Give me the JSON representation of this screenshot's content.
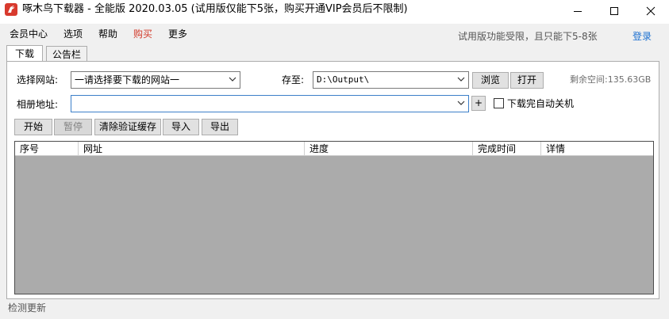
{
  "window": {
    "title": "啄木鸟下载器 - 全能版 2020.03.05 (试用版仅能下5张，购买开通VIP会员后不限制)"
  },
  "menu": {
    "items": [
      "会员中心",
      "选项",
      "帮助",
      "购买",
      "更多"
    ],
    "accent_color": "#d23a2a"
  },
  "header": {
    "trial_note": "试用版功能受限，且只能下5-8张",
    "login": "登录",
    "login_color": "#1a6fd0"
  },
  "tabs": [
    "下载",
    "公告栏"
  ],
  "form": {
    "site_label": "选择网站:",
    "site_value": "一请选择要下载的网站一",
    "save_label": "存至:",
    "save_value": "D:\\Output\\",
    "browse": "浏览",
    "open": "打开",
    "free_space": "剩余空间:135.63GB",
    "album_label": "相册地址:",
    "album_value": "",
    "plus": "+",
    "shutdown_label": "下载完自动关机",
    "shutdown_checked": false
  },
  "actions": {
    "start": "开始",
    "pause": "暂停",
    "clear_cache": "清除验证缓存",
    "import": "导入",
    "export": "导出"
  },
  "table": {
    "columns": [
      "序号",
      "网址",
      "进度",
      "完成时间",
      "详情"
    ],
    "rows": []
  },
  "status": {
    "text": "检测更新"
  }
}
